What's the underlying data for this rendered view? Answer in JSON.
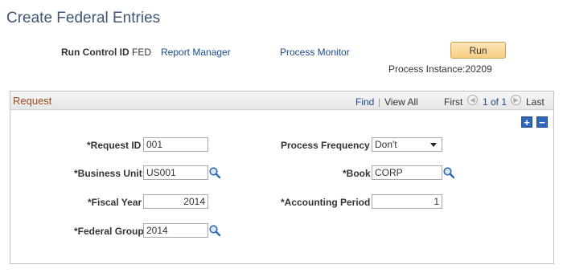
{
  "page": {
    "title": "Create Federal Entries"
  },
  "run_control": {
    "label": "Run Control ID",
    "value": "FED",
    "report_manager": "Report Manager",
    "process_monitor": "Process Monitor",
    "run_label": "Run",
    "process_instance": "Process Instance:20209"
  },
  "request": {
    "title": "Request",
    "nav": {
      "find": "Find",
      "sep": "|",
      "view_all": "View All",
      "first": "First",
      "range": "1 of 1",
      "last": "Last"
    },
    "add_label": "+",
    "delete_label": "−",
    "fields": {
      "request_id": {
        "label": "*Request ID",
        "value": "001"
      },
      "process_frequency": {
        "label": "Process Frequency",
        "value": "Don't"
      },
      "business_unit": {
        "label": "*Business Unit",
        "value": "US001"
      },
      "book": {
        "label": "*Book",
        "value": "CORP"
      },
      "fiscal_year": {
        "label": "*Fiscal Year",
        "value": "2014"
      },
      "accounting_period": {
        "label": "*Accounting Period",
        "value": "1"
      },
      "federal_group": {
        "label": "*Federal Group",
        "value": "2014"
      }
    }
  },
  "icons": {
    "lookup": "magnifier-icon",
    "prev": "prev-arrow-icon",
    "next": "next-arrow-icon",
    "add": "add-row-icon",
    "delete": "delete-row-icon"
  }
}
